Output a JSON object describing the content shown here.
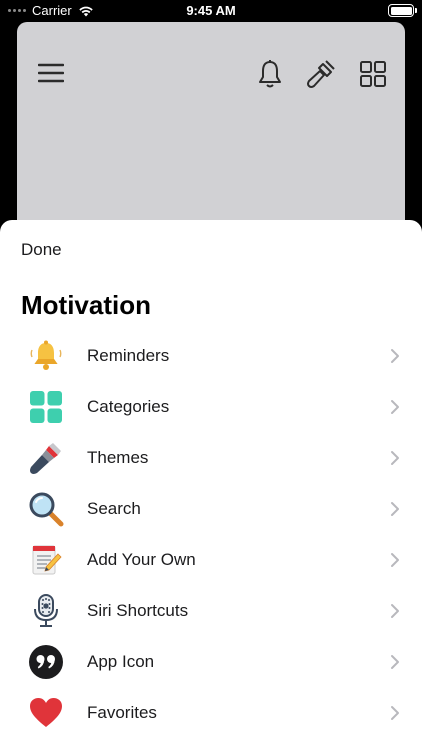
{
  "status_bar": {
    "carrier": "Carrier",
    "time": "9:45 AM"
  },
  "background_app": {
    "icons": [
      "hamburger-menu-icon",
      "bell-icon",
      "paintbrush-icon",
      "grid-icon"
    ]
  },
  "sheet": {
    "done_label": "Done",
    "title": "Motivation",
    "items": [
      {
        "label": "Reminders",
        "icon": "bell-emoji-icon"
      },
      {
        "label": "Categories",
        "icon": "category-grid-icon"
      },
      {
        "label": "Themes",
        "icon": "paintbrush-emoji-icon"
      },
      {
        "label": "Search",
        "icon": "magnifier-emoji-icon"
      },
      {
        "label": "Add Your Own",
        "icon": "notepad-pencil-icon"
      },
      {
        "label": "Siri Shortcuts",
        "icon": "microphone-icon"
      },
      {
        "label": "App Icon",
        "icon": "quote-mark-icon"
      },
      {
        "label": "Favorites",
        "icon": "heart-icon"
      }
    ]
  },
  "colors": {
    "sheet_bg": "#ffffff",
    "backdrop": "#d1d1d4",
    "teal": "#3ecfae",
    "bell_yellow": "#f6c242",
    "heart_red": "#e0343a"
  }
}
